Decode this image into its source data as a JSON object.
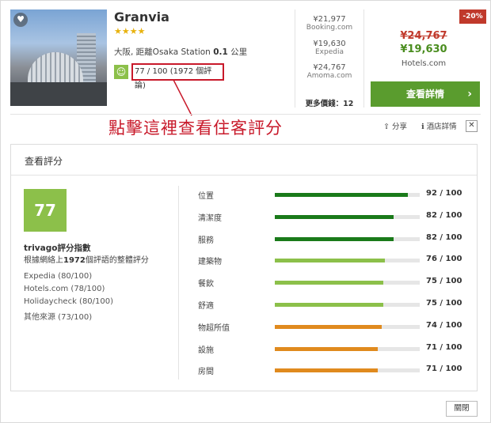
{
  "hotel": {
    "name": "Granvia",
    "stars": "★★★★",
    "location_prefix": "大阪, 距離Osaka Station",
    "distance": "0.1",
    "distance_unit": "公里",
    "score": "77",
    "score_text": "77 / 100 (1972 個評論)",
    "favorite_icon": "heart-icon"
  },
  "annotation": "點擊這裡查看住客評分",
  "offers": [
    {
      "price": "¥21,977",
      "site": "Booking.com"
    },
    {
      "price": "¥19,630",
      "site": "Expedia"
    },
    {
      "price": "¥24,767",
      "site": "Amoma.com"
    }
  ],
  "more_prices": "更多價錢：12",
  "deal": {
    "discount": "-20%",
    "old_price": "¥24,767",
    "new_price": "¥19,630",
    "site": "Hotels.com",
    "cta": "查看詳情",
    "cta_icon": "chevron-right-icon"
  },
  "actions": {
    "share": "分享",
    "details": "酒店詳情",
    "share_icon": "share-icon",
    "info_icon": "info-icon",
    "close_icon": "close-icon"
  },
  "reviews": {
    "title": "查看評分",
    "score": "77",
    "index_title": "trivago評分指數",
    "index_sub_prefix": "根據網絡上",
    "index_sub_count": "1972",
    "index_sub_suffix": "個評語的整體評分",
    "sources": [
      "Expedia (80/100)",
      "Hotels.com (78/100)",
      "Holidaycheck (80/100)",
      "其他來源 (73/100)"
    ],
    "categories": [
      {
        "label": "位置",
        "score": 92,
        "text": "92 / 100",
        "color": "#1a7a1a"
      },
      {
        "label": "清潔度",
        "score": 82,
        "text": "82 / 100",
        "color": "#1a7a1a"
      },
      {
        "label": "服務",
        "score": 82,
        "text": "82 / 100",
        "color": "#1a7a1a"
      },
      {
        "label": "建築物",
        "score": 76,
        "text": "76 / 100",
        "color": "#8cc04a"
      },
      {
        "label": "餐飲",
        "score": 75,
        "text": "75 / 100",
        "color": "#8cc04a"
      },
      {
        "label": "舒適",
        "score": 75,
        "text": "75 / 100",
        "color": "#8cc04a"
      },
      {
        "label": "物超所值",
        "score": 74,
        "text": "74 / 100",
        "color": "#e08a1e"
      },
      {
        "label": "設施",
        "score": 71,
        "text": "71 / 100",
        "color": "#e08a1e"
      },
      {
        "label": "房間",
        "score": 71,
        "text": "71 / 100",
        "color": "#e08a1e"
      }
    ]
  },
  "close_label": "關閉"
}
